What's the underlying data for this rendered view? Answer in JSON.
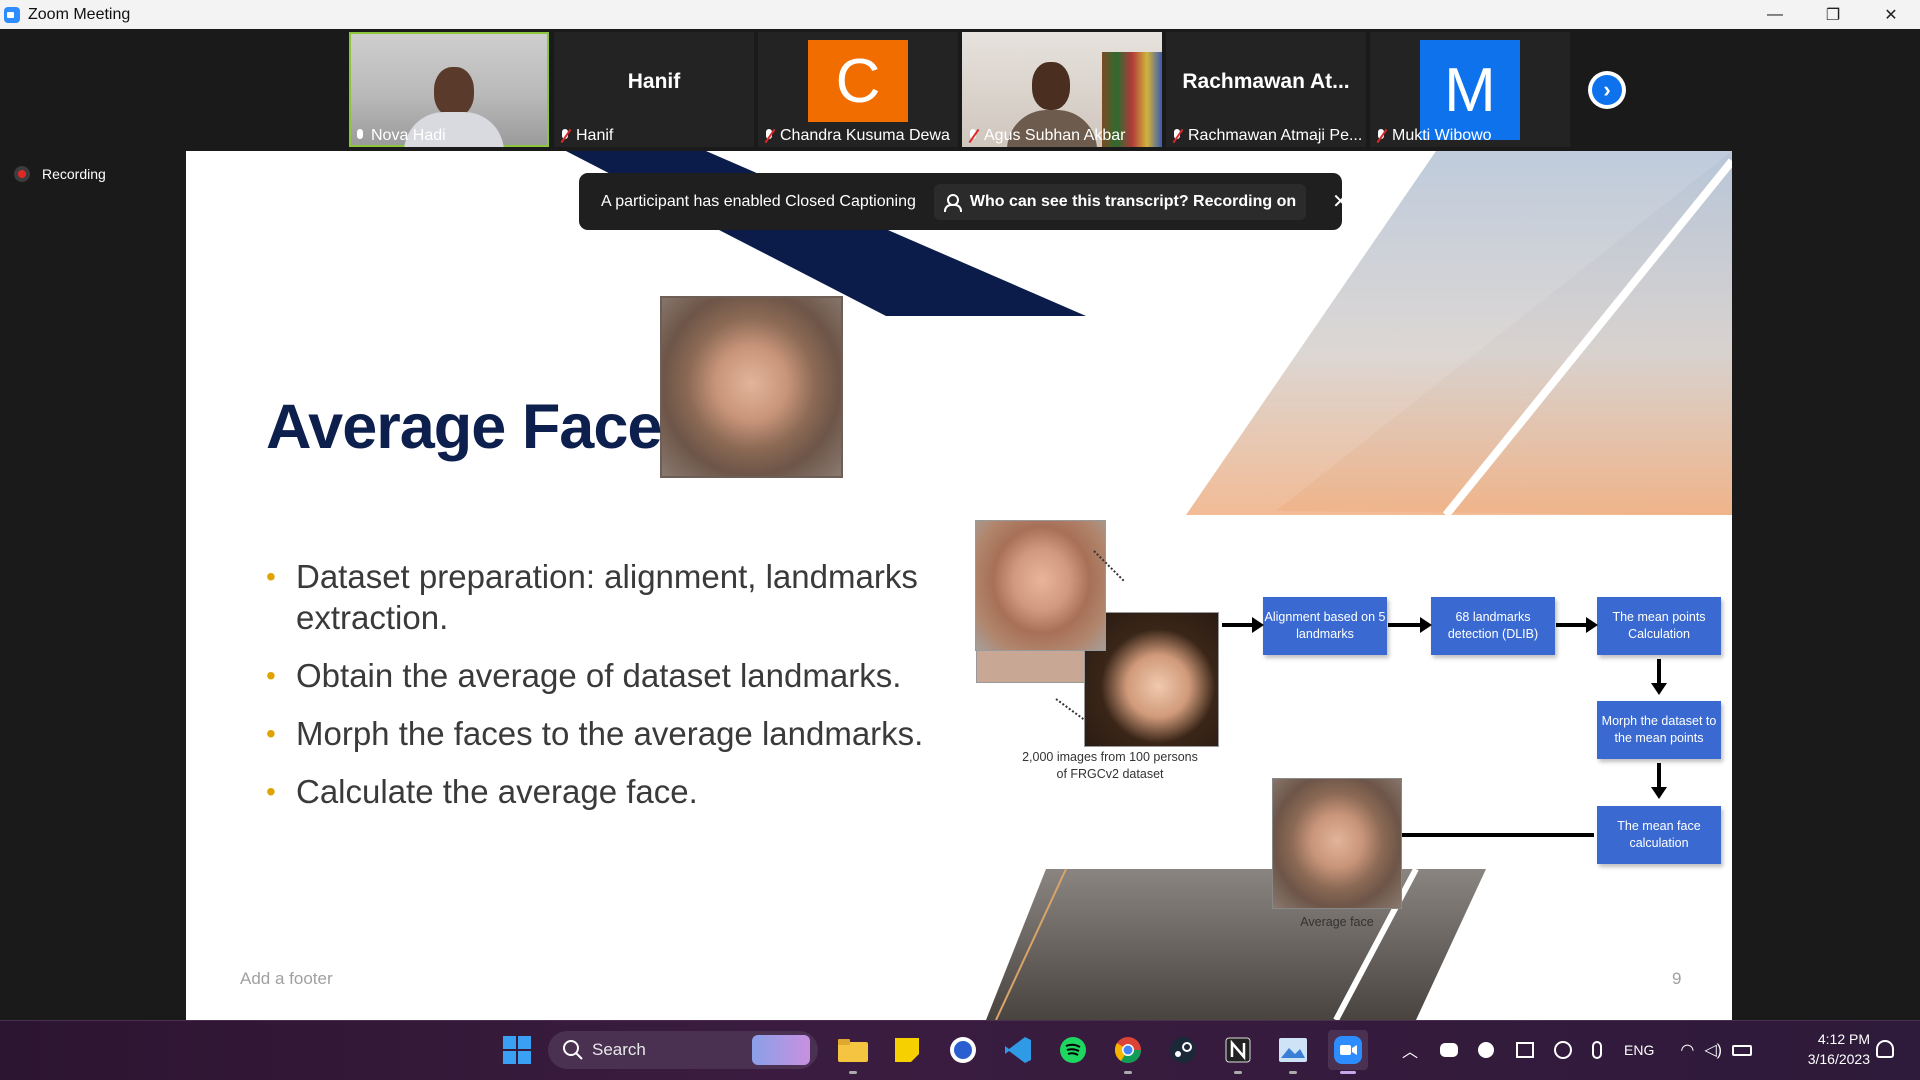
{
  "window": {
    "title": "Zoom Meeting",
    "minimize": "—",
    "restore": "❐",
    "close": "✕"
  },
  "participants": [
    {
      "name": "Nova Hadi",
      "video": true,
      "active": true
    },
    {
      "name": "Hanif",
      "big_label": "Hanif",
      "muted": true
    },
    {
      "name": "Chandra Kusuma Dewa",
      "initial": "C",
      "color": "#f26d00",
      "muted": true
    },
    {
      "name": "Agus Subhan Akbar",
      "video": true,
      "muted": true
    },
    {
      "name": "Rachmawan Atmaji Pe...",
      "big_label": "Rachmawan   At...",
      "muted": true
    },
    {
      "name": "Mukti Wibowo",
      "initial": "M",
      "color": "#0e72ed",
      "muted": true
    }
  ],
  "gallery": {
    "next_icon": "›"
  },
  "recording": {
    "label": "Recording"
  },
  "banner": {
    "message": "A participant has enabled Closed Captioning",
    "pill": "Who can see this transcript? Recording on",
    "close": "✕"
  },
  "slide": {
    "title": "Average Face",
    "bullets": [
      "Dataset preparation: alignment, landmarks extraction.",
      "Obtain the average of dataset landmarks.",
      "Morph the faces to the average landmarks.",
      "Calculate the average face."
    ],
    "diagram": {
      "boxes": [
        "Alignment based on 5 landmarks",
        "68 landmarks detection (DLIB)",
        "The mean points Calculation",
        "Morph the dataset to the mean points",
        "The mean face calculation"
      ],
      "dataset_caption": "2,000 images from 100 persons of FRGCv2 dataset",
      "avg_caption": "Average face"
    },
    "footer": "Add a footer",
    "page_number": "9"
  },
  "taskbar": {
    "search": "Search",
    "lang": "ENG",
    "time": "4:12 PM",
    "date": "3/16/2023"
  },
  "colors": {
    "accent": "#2d8cff",
    "flowbox": "#3a6ad1",
    "title": "#0d1f4d",
    "bullet": "#e0a400"
  }
}
